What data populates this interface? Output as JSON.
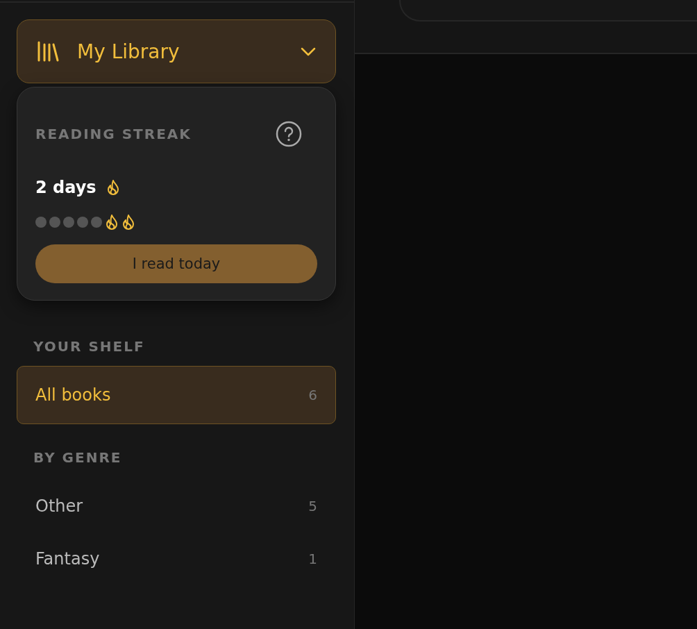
{
  "library_menu": {
    "label": "My Library",
    "expanded": false
  },
  "streak": {
    "title": "READING STREAK",
    "count": "2 days",
    "days": [
      {
        "done": false
      },
      {
        "done": false
      },
      {
        "done": false
      },
      {
        "done": false
      },
      {
        "done": false
      },
      {
        "done": true
      },
      {
        "done": true
      }
    ],
    "button": "I read today"
  },
  "shelf": {
    "heading": "YOUR SHELF",
    "items": [
      {
        "label": "All books",
        "count": "6",
        "selected": true
      }
    ]
  },
  "genres": {
    "heading": "BY GENRE",
    "items": [
      {
        "label": "Other",
        "count": "5",
        "selected": false
      },
      {
        "label": "Fantasy",
        "count": "1",
        "selected": false
      }
    ]
  }
}
